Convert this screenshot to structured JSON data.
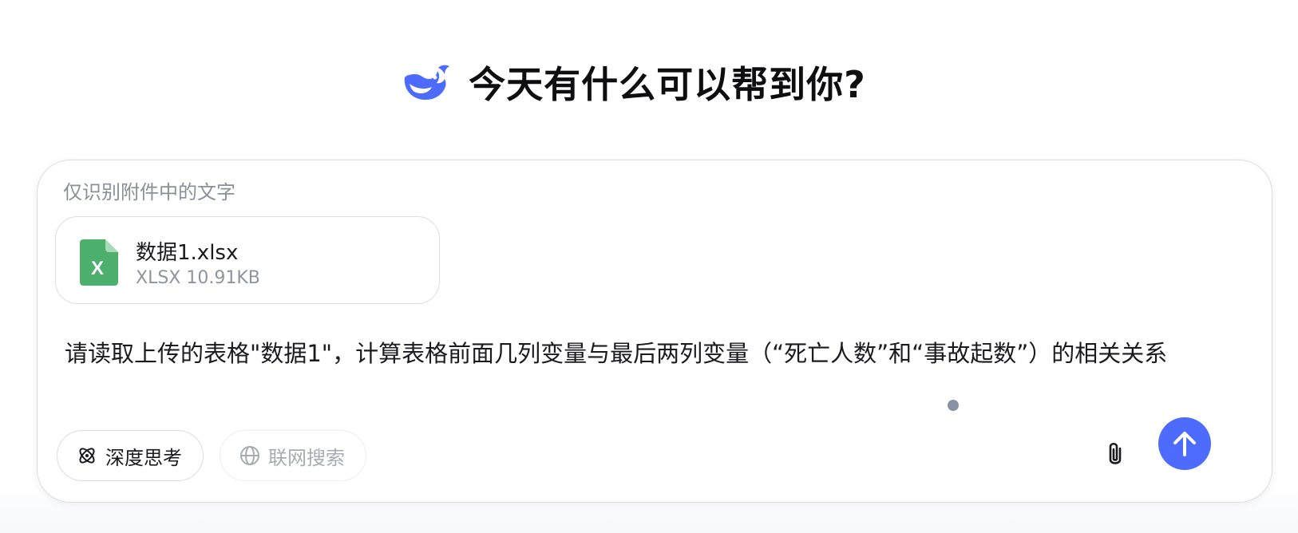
{
  "header": {
    "title": "今天有什么可以帮到你?",
    "logo_icon": "deepseek-whale-icon",
    "brand_color": "#4d6bfe"
  },
  "composer": {
    "hint": "仅识别附件中的文字",
    "attachment": {
      "name": "数据1.xlsx",
      "meta": "XLSX 10.91KB",
      "icon": "excel-file-icon",
      "icon_color": "#4caf6e"
    },
    "prompt_text": "请读取上传的表格\"数据1\"，计算表格前面几列变量与最后两列变量（“死亡人数”和“事故起数”）的相关关系",
    "buttons": {
      "deep_think_label": "深度思考",
      "deep_think_icon": "atom-icon",
      "web_search_label": "联网搜索",
      "web_search_icon": "globe-icon",
      "attach_icon": "paperclip-icon",
      "send_icon": "arrow-up-icon"
    }
  }
}
